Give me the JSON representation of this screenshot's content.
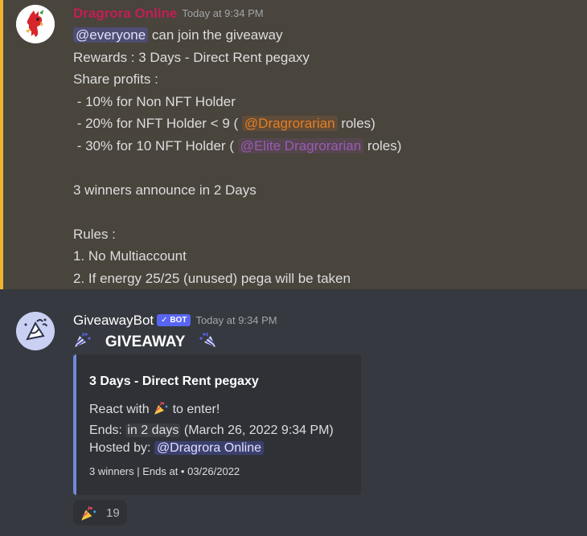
{
  "message1": {
    "author": "Dragrora Online",
    "timestamp": "Today at 9:34 PM",
    "mention_everyone": "@everyone",
    "line1_rest": " can join the giveaway",
    "line2": "Rewards : 3 Days - Direct Rent pegaxy",
    "line3": "Share profits :",
    "line4": " - 10% for Non NFT Holder",
    "line5_pre": " - 20% for NFT Holder < 9 ( ",
    "role1": "@Dragrorarian",
    "line5_post": " roles)",
    "line6_pre": " - 30% for 10 NFT Holder ( ",
    "role2": "@Elite Dragrorarian",
    "line6_post": " roles)",
    "line7": "3 winners announce in 2 Days",
    "line8": "Rules :",
    "line9": "1. No Multiaccount",
    "line10": "2. If energy 25/25 (unused) pega will be taken"
  },
  "message2": {
    "author": "GiveawayBot",
    "badge": "✓ BOT",
    "timestamp": "Today at 9:34 PM",
    "title": "GIVEAWAY",
    "embed": {
      "title": "3 Days - Direct Rent pegaxy",
      "react_pre": "React with ",
      "react_post": " to enter!",
      "ends_label": "Ends: ",
      "ends_value": "in 2 days",
      "ends_date": "(March 26, 2022 9:34 PM)",
      "hosted_label": "Hosted by: ",
      "host": "@Dragrora Online",
      "footer": "3 winners | Ends at • 03/26/2022"
    },
    "reaction": {
      "emoji": "party-popper-icon",
      "count": "19"
    }
  },
  "colors": {
    "highlight_bg": "#49443c",
    "highlight_border": "#f0b232",
    "author_red": "#c21e56",
    "embed_border": "#7289da",
    "role_orange": "#e67e22",
    "role_purple": "#9b59b6"
  }
}
